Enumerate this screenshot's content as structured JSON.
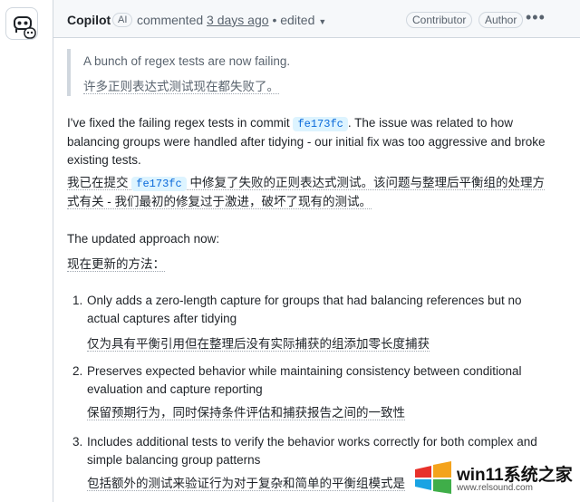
{
  "comment": {
    "author": "Copilot",
    "ai_badge": "AI",
    "action": "commented",
    "time": "3 days ago",
    "edited": "edited",
    "roles": [
      "Contributor",
      "Author"
    ],
    "menu_icon": "kebab-horizontal-icon",
    "avatar_icon": "copilot-icon"
  },
  "quote": {
    "en": "A bunch of regex tests are now failing.",
    "zh": "许多正则表达式测试现在都失败了。"
  },
  "intro": {
    "en_before": "I've fixed the failing regex tests in commit",
    "commit": "fe173fc",
    "en_after": ". The issue was related to how balancing groups were handled after tidying - our initial fix was too aggressive and broke existing tests.",
    "zh_before": "我已在提交",
    "zh_after": "中修复了失败的正则表达式测试。该问题与整理后平衡组的处理方式有关 - 我们最初的修复过于激进，破坏了现有的测试。"
  },
  "approach": {
    "en": "The updated approach now:",
    "zh": "现在更新的方法："
  },
  "items": [
    {
      "num": "1.",
      "en": "Only adds a zero-length capture for groups that had balancing references but no actual captures after tidying",
      "zh": "仅为具有平衡引用但在整理后没有实际捕获的组添加零长度捕获"
    },
    {
      "num": "2.",
      "en": "Preserves expected behavior while maintaining consistency between conditional evaluation and capture reporting",
      "zh": "保留预期行为，同时保持条件评估和捕获报告之间的一致性"
    },
    {
      "num": "3.",
      "en": "Includes additional tests to verify the behavior works correctly for both complex and simple balancing group patterns",
      "zh": "包括额外的测试来验证行为对于复杂和简单的平衡组模式是"
    }
  ],
  "watermark": {
    "brand": "win11系统之家",
    "url": "www.relsound.com",
    "colors": [
      "#e8312a",
      "#f4a31c",
      "#19a3e3",
      "#3fae49"
    ]
  }
}
